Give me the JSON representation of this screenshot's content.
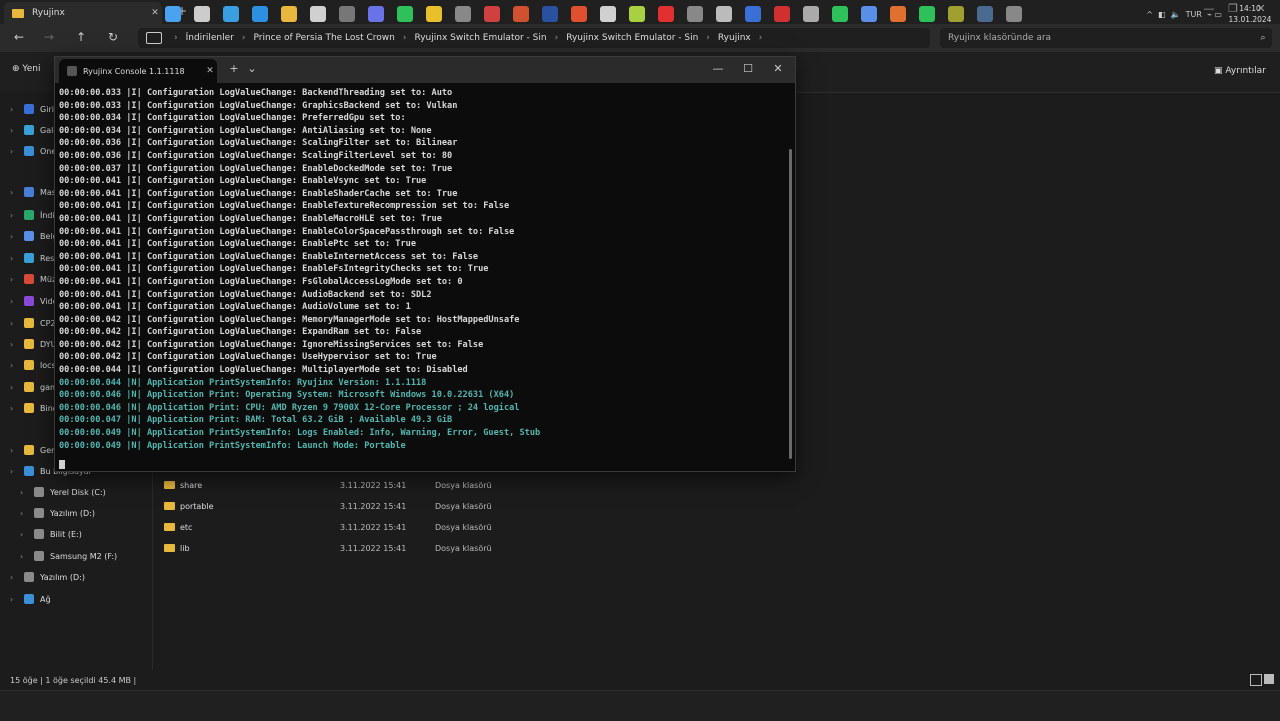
{
  "explorer": {
    "tab_title": "Ryujinx",
    "breadcrumb": [
      "İndirilenler",
      "Prince of Persia The Lost Crown",
      "Ryujinx Switch Emulator - Sin",
      "Ryujinx Switch Emulator - Sin",
      "Ryujinx"
    ],
    "search_placeholder": "Ryujinx klasöründe ara",
    "new_label": "Yeni",
    "details_label": "Ayrıntılar",
    "sidebar": [
      {
        "label": "Giriş",
        "color": "#3a6fd8"
      },
      {
        "label": "Galeri",
        "color": "#3aa0d8"
      },
      {
        "label": "OneDrive",
        "color": "#3a8fd8"
      },
      {
        "label": "Masaüstü",
        "color": "#4a7fd8"
      },
      {
        "label": "İndirilenler",
        "color": "#2aa86a"
      },
      {
        "label": "Belgeler",
        "color": "#5a8fe8"
      },
      {
        "label": "Resimler",
        "color": "#3a9fd8"
      },
      {
        "label": "Müzik",
        "color": "#d84a3a"
      },
      {
        "label": "Videolar",
        "color": "#8a4ad8"
      },
      {
        "label": "CP2",
        "color": "#e8b83c"
      },
      {
        "label": "DYU",
        "color": "#e8b83c"
      },
      {
        "label": "locs",
        "color": "#e8b83c"
      },
      {
        "label": "games",
        "color": "#e8b83c"
      },
      {
        "label": "Bino",
        "color": "#e8b83c"
      },
      {
        "label": "Genel",
        "color": "#e8b83c"
      },
      {
        "label": "Bu bilgisayar",
        "color": "#3a8fd8"
      },
      {
        "label": "Yerel Disk (C:)",
        "color": "#8a8a8a"
      },
      {
        "label": "Yazılım (D:)",
        "color": "#8a8a8a"
      },
      {
        "label": "Bilit (E:)",
        "color": "#8a8a8a"
      },
      {
        "label": "Samsung M2 (F:)",
        "color": "#8a8a8a"
      },
      {
        "label": "Yazılım (D:)",
        "color": "#8a8a8a"
      },
      {
        "label": "Ağ",
        "color": "#3a8fd8"
      }
    ],
    "files": [
      {
        "name": "share",
        "date": "3.11.2022 15:41",
        "type": "Dosya klasörü"
      },
      {
        "name": "portable",
        "date": "3.11.2022 15:41",
        "type": "Dosya klasörü"
      },
      {
        "name": "etc",
        "date": "3.11.2022 15:41",
        "type": "Dosya klasörü"
      },
      {
        "name": "lib",
        "date": "3.11.2022 15:41",
        "type": "Dosya klasörü"
      }
    ],
    "status": "15 öğe  |  1 öğe seçildi  45.4 MB  |"
  },
  "terminal": {
    "title": "Ryujinx Console 1.1.1118",
    "lines": [
      {
        "text": "00:00:00.033 |I| Configuration LogValueChange: BackendThreading set to: Auto",
        "level": "I"
      },
      {
        "text": "00:00:00.033 |I| Configuration LogValueChange: GraphicsBackend set to: Vulkan",
        "level": "I"
      },
      {
        "text": "00:00:00.034 |I| Configuration LogValueChange: PreferredGpu set to:",
        "level": "I"
      },
      {
        "text": "00:00:00.034 |I| Configuration LogValueChange: AntiAliasing set to: None",
        "level": "I"
      },
      {
        "text": "00:00:00.036 |I| Configuration LogValueChange: ScalingFilter set to: Bilinear",
        "level": "I"
      },
      {
        "text": "00:00:00.036 |I| Configuration LogValueChange: ScalingFilterLevel set to: 80",
        "level": "I"
      },
      {
        "text": "00:00:00.037 |I| Configuration LogValueChange: EnableDockedMode set to: True",
        "level": "I"
      },
      {
        "text": "00:00:00.041 |I| Configuration LogValueChange: EnableVsync set to: True",
        "level": "I"
      },
      {
        "text": "00:00:00.041 |I| Configuration LogValueChange: EnableShaderCache set to: True",
        "level": "I"
      },
      {
        "text": "00:00:00.041 |I| Configuration LogValueChange: EnableTextureRecompression set to: False",
        "level": "I"
      },
      {
        "text": "00:00:00.041 |I| Configuration LogValueChange: EnableMacroHLE set to: True",
        "level": "I"
      },
      {
        "text": "00:00:00.041 |I| Configuration LogValueChange: EnableColorSpacePassthrough set to: False",
        "level": "I"
      },
      {
        "text": "00:00:00.041 |I| Configuration LogValueChange: EnablePtc set to: True",
        "level": "I"
      },
      {
        "text": "00:00:00.041 |I| Configuration LogValueChange: EnableInternetAccess set to: False",
        "level": "I"
      },
      {
        "text": "00:00:00.041 |I| Configuration LogValueChange: EnableFsIntegrityChecks set to: True",
        "level": "I"
      },
      {
        "text": "00:00:00.041 |I| Configuration LogValueChange: FsGlobalAccessLogMode set to: 0",
        "level": "I"
      },
      {
        "text": "00:00:00.041 |I| Configuration LogValueChange: AudioBackend set to: SDL2",
        "level": "I"
      },
      {
        "text": "00:00:00.041 |I| Configuration LogValueChange: AudioVolume set to: 1",
        "level": "I"
      },
      {
        "text": "00:00:00.042 |I| Configuration LogValueChange: MemoryManagerMode set to: HostMappedUnsafe",
        "level": "I"
      },
      {
        "text": "00:00:00.042 |I| Configuration LogValueChange: ExpandRam set to: False",
        "level": "I"
      },
      {
        "text": "00:00:00.042 |I| Configuration LogValueChange: IgnoreMissingServices set to: False",
        "level": "I"
      },
      {
        "text": "00:00:00.042 |I| Configuration LogValueChange: UseHypervisor set to: True",
        "level": "I"
      },
      {
        "text": "00:00:00.044 |I| Configuration LogValueChange: MultiplayerMode set to: Disabled",
        "level": "I"
      },
      {
        "text": "00:00:00.044 |N| Application PrintSystemInfo: Ryujinx Version: 1.1.1118",
        "level": "N"
      },
      {
        "text": "00:00:00.046 |N| Application Print: Operating System: Microsoft Windows 10.0.22631 (X64)",
        "level": "N"
      },
      {
        "text": "00:00:00.046 |N| Application Print: CPU: AMD Ryzen 9 7900X 12-Core Processor ; 24 logical",
        "level": "N"
      },
      {
        "text": "00:00:00.047 |N| Application Print: RAM: Total 63.2 GiB ; Available 49.3 GiB",
        "level": "N"
      },
      {
        "text": "00:00:00.049 |N| Application PrintSystemInfo: Logs Enabled: Info, Warning, Error, Guest, Stub",
        "level": "N"
      },
      {
        "text": "00:00:00.049 |N| Application PrintSystemInfo: Launch Mode: Portable",
        "level": "N"
      }
    ]
  },
  "colors": {
    "info_text": "#d8d8d8",
    "notice_text": "#52b6b0"
  },
  "taskbar": {
    "apps": [
      {
        "name": "start-icon",
        "color": "#4aa3f0"
      },
      {
        "name": "search-icon",
        "color": "#cccccc"
      },
      {
        "name": "edge-icon",
        "color": "#3a9fe0"
      },
      {
        "name": "vscode-icon",
        "color": "#2d8fe0"
      },
      {
        "name": "explorer-icon",
        "color": "#e8b83c"
      },
      {
        "name": "store-icon",
        "color": "#d0d0d0"
      },
      {
        "name": "app-icon",
        "color": "#777777"
      },
      {
        "name": "discord-icon",
        "color": "#6a72e8"
      },
      {
        "name": "spotify-icon",
        "color": "#2ec05a"
      },
      {
        "name": "chrome-icon",
        "color": "#e8c02a"
      },
      {
        "name": "app-icon",
        "color": "#888888"
      },
      {
        "name": "app-icon",
        "color": "#d04040"
      },
      {
        "name": "app-icon",
        "color": "#d05030"
      },
      {
        "name": "app-icon",
        "color": "#2a50a0"
      },
      {
        "name": "brave-icon",
        "color": "#e05030"
      },
      {
        "name": "app-icon",
        "color": "#d0d0d0"
      },
      {
        "name": "app-icon",
        "color": "#a8d040"
      },
      {
        "name": "app-icon",
        "color": "#e03030"
      },
      {
        "name": "app-icon",
        "color": "#888888"
      },
      {
        "name": "app-icon",
        "color": "#bbbbbb"
      },
      {
        "name": "app-icon",
        "color": "#3a6fd8"
      },
      {
        "name": "app-icon",
        "color": "#d03030"
      },
      {
        "name": "app-icon",
        "color": "#aaaaaa"
      },
      {
        "name": "app-icon",
        "color": "#2ec05a"
      },
      {
        "name": "app-icon",
        "color": "#5a8fe8"
      },
      {
        "name": "app-icon",
        "color": "#e07030"
      },
      {
        "name": "whatsapp-icon",
        "color": "#2ec05a"
      },
      {
        "name": "app-icon",
        "color": "#a0a030"
      },
      {
        "name": "steam-icon",
        "color": "#4a6a90"
      },
      {
        "name": "terminal-icon",
        "color": "#888888"
      }
    ],
    "tray_lang": "TUR",
    "time": "14:10",
    "date": "13.01.2024"
  }
}
